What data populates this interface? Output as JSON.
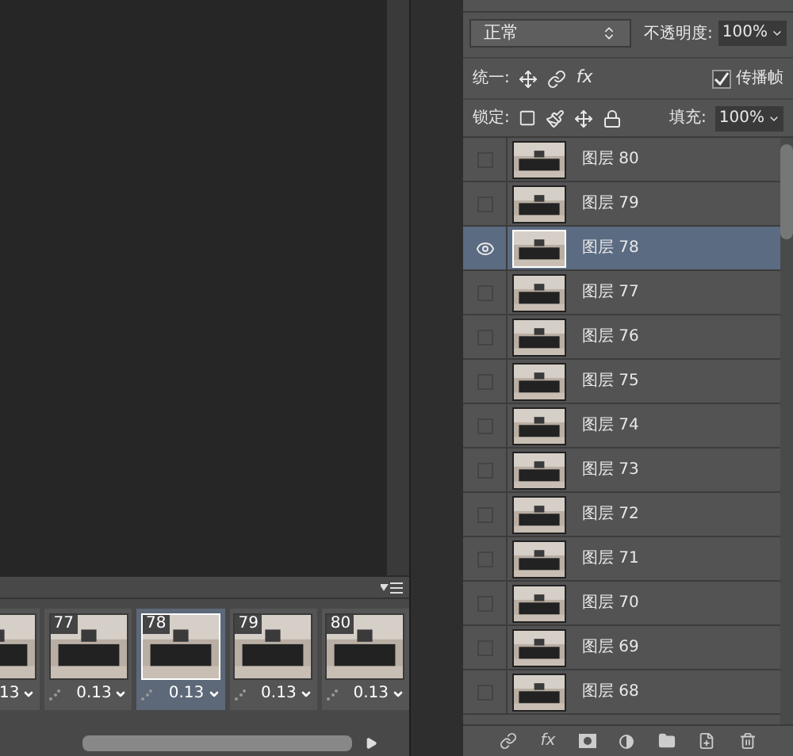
{
  "layers_panel": {
    "blend_mode": "正常",
    "opacity_label": "不透明度:",
    "opacity": "100%",
    "unify_label": "统一:",
    "unify_style_icon": "fx",
    "propagate": {
      "label": "传播帧",
      "checked": true
    },
    "lock_label": "锁定:",
    "fill_label": "填充:",
    "fill": "100%",
    "layers": [
      {
        "name": "图层 80",
        "visible": false,
        "selected": false
      },
      {
        "name": "图层 79",
        "visible": false,
        "selected": false
      },
      {
        "name": "图层 78",
        "visible": true,
        "selected": true
      },
      {
        "name": "图层 77",
        "visible": false,
        "selected": false
      },
      {
        "name": "图层 76",
        "visible": false,
        "selected": false
      },
      {
        "name": "图层 75",
        "visible": false,
        "selected": false
      },
      {
        "name": "图层 74",
        "visible": false,
        "selected": false
      },
      {
        "name": "图层 73",
        "visible": false,
        "selected": false
      },
      {
        "name": "图层 72",
        "visible": false,
        "selected": false
      },
      {
        "name": "图层 71",
        "visible": false,
        "selected": false
      },
      {
        "name": "图层 70",
        "visible": false,
        "selected": false
      },
      {
        "name": "图层 69",
        "visible": false,
        "selected": false
      },
      {
        "name": "图层 68",
        "visible": false,
        "selected": false
      }
    ]
  },
  "layers_footer": {
    "fx_button": "fx"
  },
  "timeline": {
    "frames": [
      {
        "delay": "13",
        "selected": false
      },
      {
        "number": "77",
        "delay": "0.13",
        "selected": false
      },
      {
        "number": "78",
        "delay": "0.13",
        "selected": true
      },
      {
        "number": "79",
        "delay": "0.13",
        "selected": false
      },
      {
        "number": "80",
        "delay": "0.13",
        "selected": false
      }
    ]
  }
}
